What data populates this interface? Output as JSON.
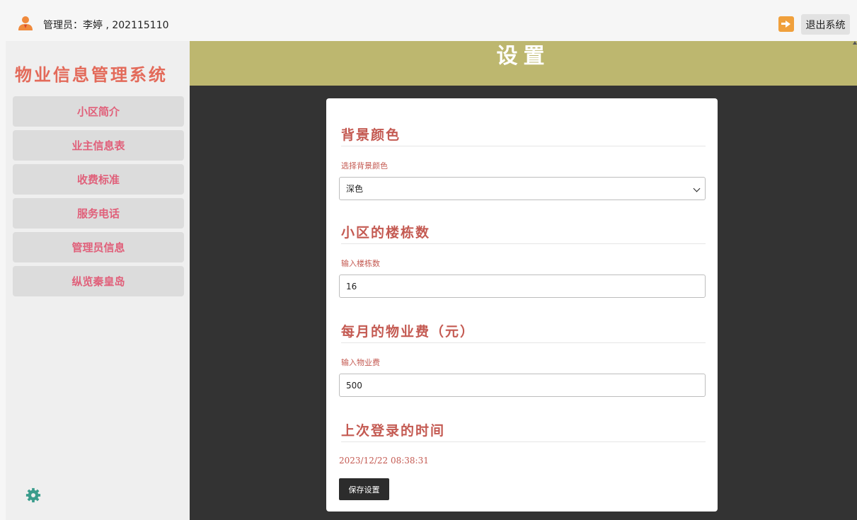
{
  "topbar": {
    "user_text": "管理员：李婷 , 202115110",
    "exit_label": "退出系统"
  },
  "sidebar": {
    "app_title": "物业信息管理系统",
    "items": [
      {
        "label": "小区简介"
      },
      {
        "label": "业主信息表"
      },
      {
        "label": "收费标准"
      },
      {
        "label": "服务电话"
      },
      {
        "label": "管理员信息"
      },
      {
        "label": "纵览秦皇岛"
      }
    ]
  },
  "main": {
    "header_title": "设置",
    "sections": {
      "background": {
        "title": "背景颜色",
        "label": "选择背景颜色",
        "value": "深色"
      },
      "buildings": {
        "title": "小区的楼栋数",
        "label": "输入楼栋数",
        "value": "16"
      },
      "fee": {
        "title": "每月的物业费（元）",
        "label": "输入物业费",
        "value": "500"
      },
      "last_login": {
        "title": "上次登录的时间",
        "value": "2023/12/22 08:38:31"
      }
    },
    "save_label": "保存设置"
  },
  "colors": {
    "header_bg": "#bdb76f",
    "main_bg": "#333333",
    "accent_text": "#c45a52",
    "nav_text": "#e0607a",
    "title_text": "#e36a5a",
    "gear": "#3a9c8c"
  },
  "icons": [
    "user-icon",
    "exit-icon",
    "gear-icon",
    "chevron-down-icon"
  ]
}
